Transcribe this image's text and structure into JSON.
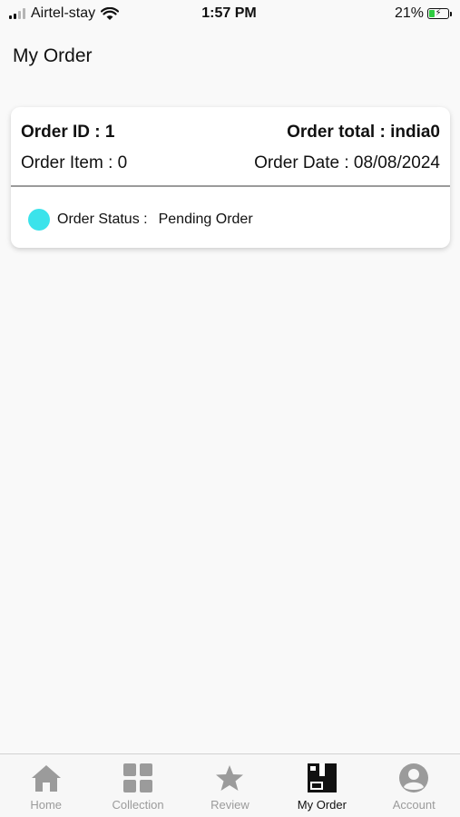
{
  "status_bar": {
    "carrier": "Airtel-stay",
    "time": "1:57 PM",
    "battery": "21%"
  },
  "header": {
    "title": "My Order"
  },
  "order": {
    "id_label": "Order ID : 1",
    "total_label": "Order total : india0",
    "item_label": "Order Item : 0",
    "date_label": "Order Date : 08/08/2024",
    "status_label": "Order Status :",
    "status_value": "Pending Order",
    "status_color": "#3be3eb"
  },
  "nav": {
    "items": [
      {
        "label": "Home",
        "icon": "home-icon"
      },
      {
        "label": "Collection",
        "icon": "grid-icon"
      },
      {
        "label": "Review",
        "icon": "star-icon"
      },
      {
        "label": "My Order",
        "icon": "order-box-icon",
        "active": true
      },
      {
        "label": "Account",
        "icon": "account-icon"
      }
    ]
  }
}
